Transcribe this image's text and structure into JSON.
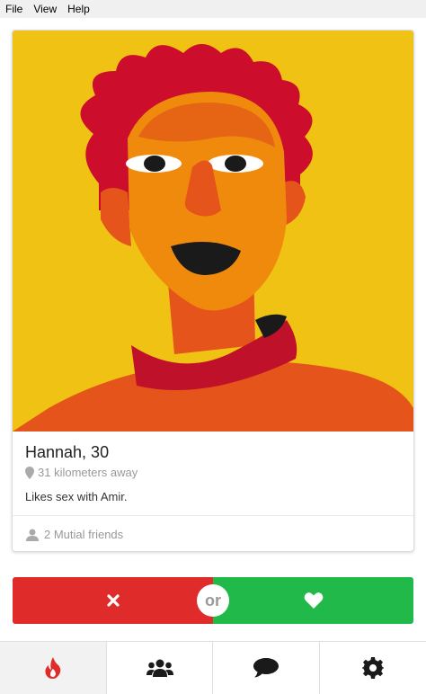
{
  "menu": {
    "items": [
      "File",
      "View",
      "Help"
    ]
  },
  "profile": {
    "name_age": "Hannah, 30",
    "distance": "31 kilometers away",
    "bio": "Likes sex with Amir.",
    "mutual_friends": "2 Mutial friends",
    "photo_icon": "illustrated-portrait"
  },
  "actions": {
    "nope_icon": "x-icon",
    "or_label": "or",
    "like_icon": "heart-icon",
    "nope_color": "#e02b2b",
    "like_color": "#21b949"
  },
  "nav": {
    "tabs": [
      {
        "icon": "flame-icon",
        "active": true
      },
      {
        "icon": "users-icon",
        "active": false
      },
      {
        "icon": "chat-icon",
        "active": false
      },
      {
        "icon": "gear-icon",
        "active": false
      }
    ],
    "accent": "#e02b2b"
  }
}
